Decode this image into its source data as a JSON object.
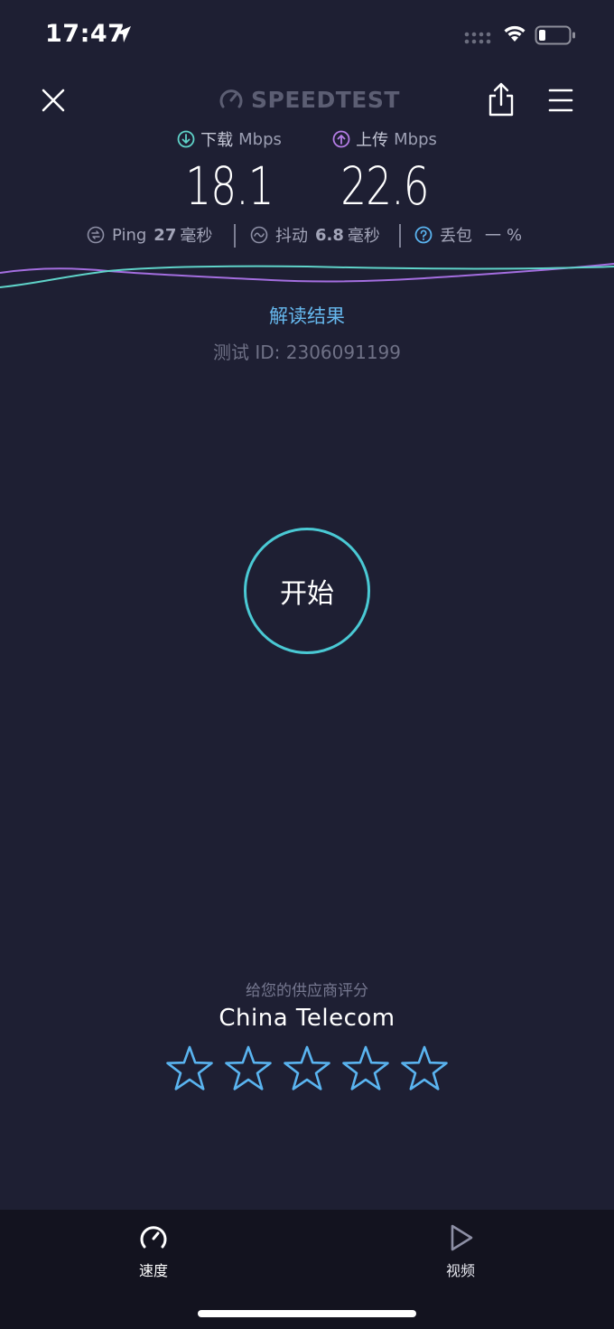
{
  "status_bar": {
    "time": "17:47",
    "icons": [
      "location-arrow-icon",
      "signal-dots-icon",
      "wifi-icon",
      "battery-icon"
    ]
  },
  "header": {
    "brand": "SPEEDTEST",
    "icons": [
      "close-icon",
      "gauge-icon",
      "share-icon",
      "menu-icon"
    ]
  },
  "results": {
    "download": {
      "label": "下载",
      "unit": "Mbps",
      "value": "18.1",
      "color": "#5fd3c9"
    },
    "upload": {
      "label": "上传",
      "unit": "Mbps",
      "value": "22.6",
      "color": "#b57de6"
    }
  },
  "metrics": {
    "ping": {
      "label": "Ping",
      "value": "27",
      "unit": "毫秒"
    },
    "jitter": {
      "label": "抖动",
      "value": "6.8",
      "unit": "毫秒"
    },
    "loss": {
      "label": "丢包",
      "value": "一",
      "unit": "%"
    }
  },
  "graph": {
    "download_color": "#5fd3c9",
    "upload_color": "#a46ee0"
  },
  "interpret_link": "解读结果",
  "test_id": "测试 ID: 2306091199",
  "start_button": "开始",
  "rating": {
    "prompt": "给您的供应商评分",
    "provider": "China Telecom",
    "max_stars": 5,
    "filled_stars": 0,
    "star_color": "#5ab4f0"
  },
  "tabs": [
    {
      "label": "速度",
      "icon": "speedometer-icon",
      "active": true
    },
    {
      "label": "视频",
      "icon": "play-icon",
      "active": false
    }
  ],
  "colors": {
    "background": "#1e1f33",
    "tabbar": "#13131f",
    "accent_ring": "#4ac9d4",
    "link": "#66b8ee"
  }
}
